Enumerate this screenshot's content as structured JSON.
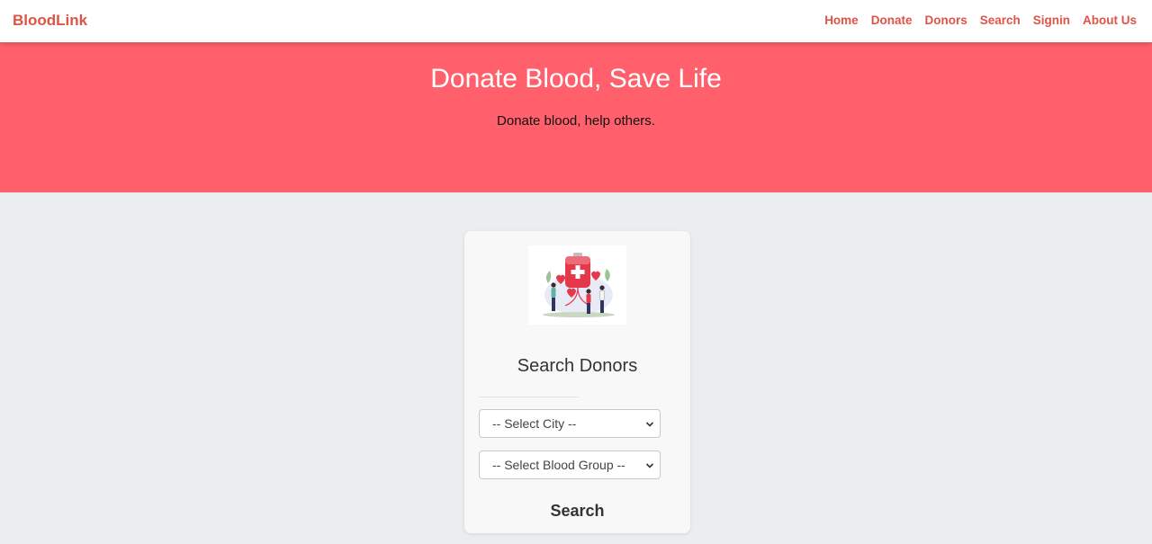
{
  "navbar": {
    "brand": "BloodLink",
    "links": [
      "Home",
      "Donate",
      "Donors",
      "Search",
      "Signin",
      "About Us"
    ]
  },
  "hero": {
    "title": "Donate Blood, Save Life",
    "subtitle": "Donate blood, help others."
  },
  "search_card": {
    "title": "Search Donors",
    "city_select": {
      "selected": "-- Select City --"
    },
    "blood_group_select": {
      "selected": "-- Select Blood Group --"
    },
    "search_button": "Search"
  },
  "colors": {
    "brand": "#df5346",
    "hero_bg": "#ff606c",
    "page_bg": "#ebeeef",
    "card_bg": "#f8f8f8"
  }
}
